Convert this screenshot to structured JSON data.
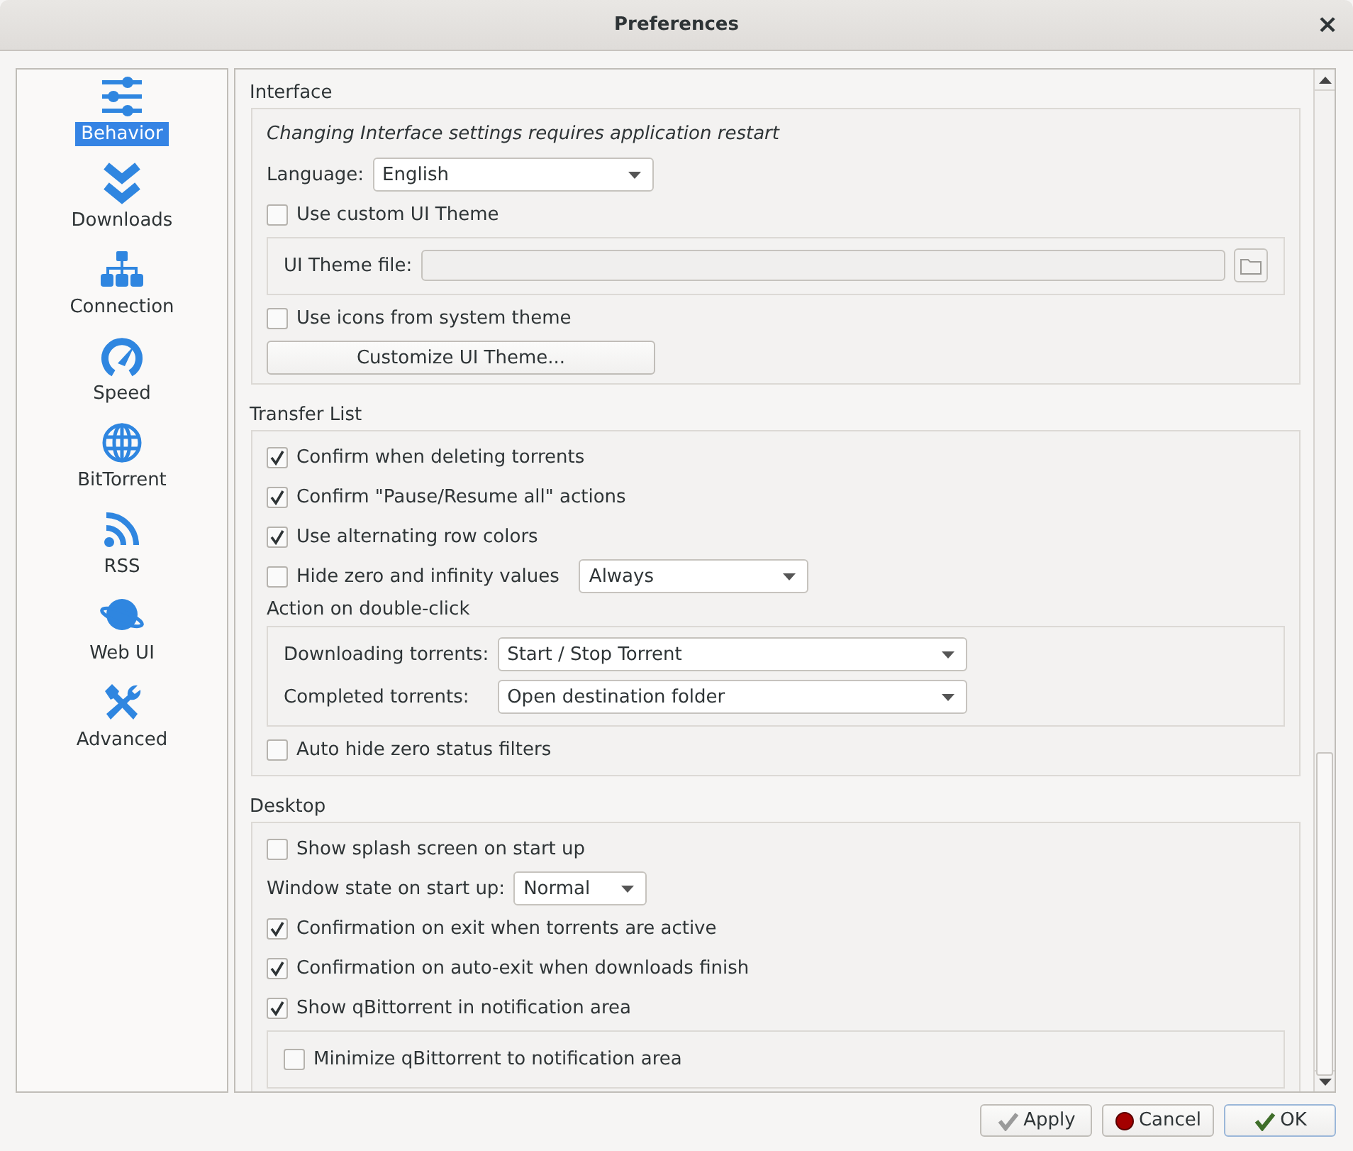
{
  "window": {
    "title": "Preferences",
    "close": "×"
  },
  "sidebar": {
    "items": [
      {
        "label": "Behavior",
        "selected": true
      },
      {
        "label": "Downloads",
        "selected": false
      },
      {
        "label": "Connection",
        "selected": false
      },
      {
        "label": "Speed",
        "selected": false
      },
      {
        "label": "BitTorrent",
        "selected": false
      },
      {
        "label": "RSS",
        "selected": false
      },
      {
        "label": "Web UI",
        "selected": false
      },
      {
        "label": "Advanced",
        "selected": false
      }
    ]
  },
  "sections": [
    {
      "title": "Interface",
      "items": [
        {
          "kind": "note",
          "text": "Changing Interface settings requires application restart"
        },
        {
          "kind": "combo",
          "label": "Language:",
          "value": "English"
        },
        {
          "kind": "checkbox",
          "label": "Use custom UI Theme",
          "checked": false
        },
        {
          "kind": "panel",
          "items": [
            {
              "kind": "file",
              "label": "UI Theme file:"
            }
          ]
        },
        {
          "kind": "checkbox",
          "label": "Use icons from system theme",
          "checked": false
        },
        {
          "kind": "button",
          "label": "Customize UI Theme..."
        }
      ]
    },
    {
      "title": "Transfer List",
      "items": [
        {
          "kind": "checkbox",
          "label": "Confirm when deleting torrents",
          "checked": true
        },
        {
          "kind": "checkbox",
          "label": "Confirm \"Pause/Resume all\" actions",
          "checked": true
        },
        {
          "kind": "checkbox",
          "label": "Use alternating row colors",
          "checked": true
        },
        {
          "kind": "checkbox-combo",
          "label": "Hide zero and infinity values",
          "checked": false,
          "value": "Always"
        },
        {
          "kind": "heading",
          "text": "Action on double-click"
        },
        {
          "kind": "panel",
          "items": [
            {
              "kind": "combo",
              "label": "Downloading torrents:",
              "value": "Start / Stop Torrent"
            },
            {
              "kind": "combo",
              "label": "Completed torrents:",
              "value": "Open destination folder"
            }
          ]
        },
        {
          "kind": "checkbox",
          "label": "Auto hide zero status filters",
          "checked": false
        }
      ]
    },
    {
      "title": "Desktop",
      "items": [
        {
          "kind": "checkbox",
          "label": "Show splash screen on start up",
          "checked": false
        },
        {
          "kind": "combo",
          "label": "Window state on start up:",
          "value": "Normal"
        },
        {
          "kind": "checkbox",
          "label": "Confirmation on exit when torrents are active",
          "checked": true
        },
        {
          "kind": "checkbox",
          "label": "Confirmation on auto-exit when downloads finish",
          "checked": true
        },
        {
          "kind": "checkbox",
          "label": "Show qBittorrent in notification area",
          "checked": true
        },
        {
          "kind": "panel",
          "items": [
            {
              "kind": "checkbox",
              "label": "Minimize qBittorrent to notification area",
              "checked": false
            }
          ]
        }
      ]
    }
  ],
  "buttons": [
    {
      "label": "Apply",
      "kind": "apply"
    },
    {
      "label": "Cancel",
      "kind": "cancel"
    },
    {
      "label": "OK",
      "kind": "ok"
    }
  ]
}
